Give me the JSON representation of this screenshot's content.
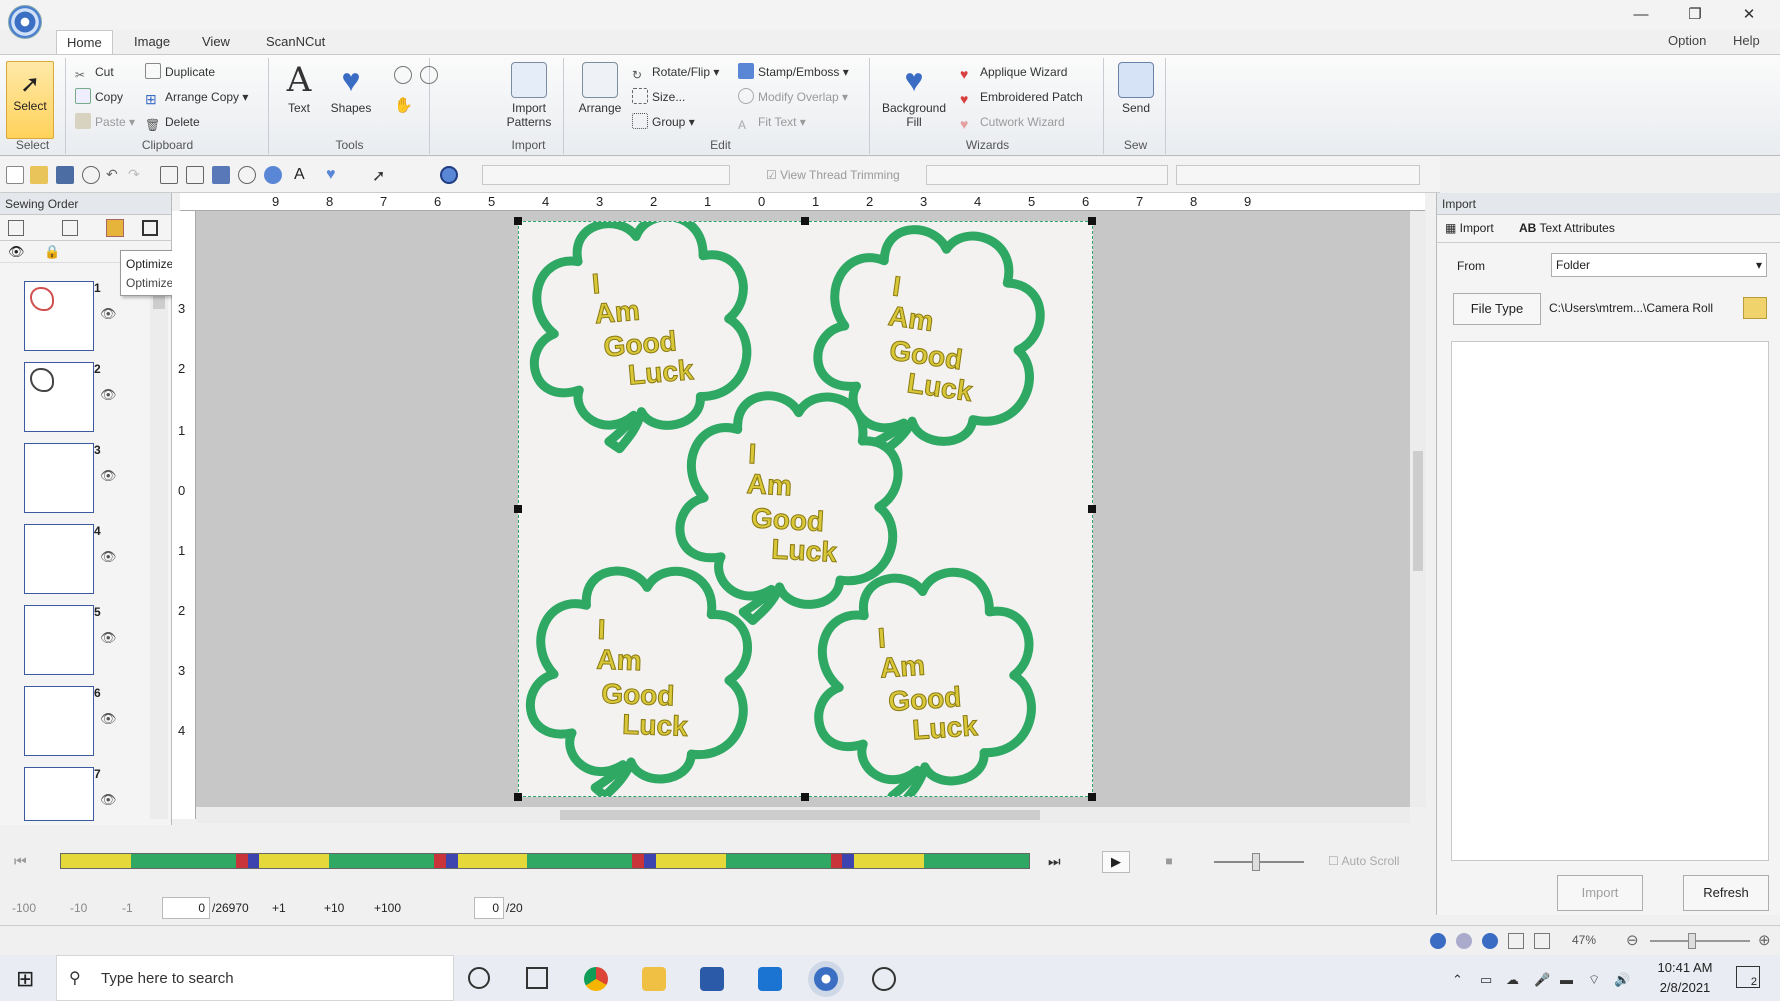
{
  "window": {
    "minimize": "—",
    "restore": "❐",
    "close": "✕"
  },
  "menu": {
    "tabs": [
      "Home",
      "Image",
      "View",
      "ScanNCut"
    ],
    "option": "Option",
    "help": "Help"
  },
  "ribbon": {
    "select": {
      "label": "Select",
      "group": "Select"
    },
    "clipboard": {
      "cut": "Cut",
      "copy": "Copy",
      "paste": "Paste",
      "duplicate": "Duplicate",
      "arrange_copy": "Arrange Copy",
      "delete": "Delete",
      "group": "Clipboard"
    },
    "tools": {
      "text": "Text",
      "shapes": "Shapes",
      "group": "Tools"
    },
    "import": {
      "label": "Import Patterns",
      "group": "Import"
    },
    "edit": {
      "arrange": "Arrange",
      "rotate_flip": "Rotate/Flip",
      "size": "Size...",
      "group_btn": "Group",
      "stamp": "Stamp/Emboss",
      "modify_overlap": "Modify Overlap",
      "fit_text": "Fit Text",
      "group": "Edit"
    },
    "wizards": {
      "background_fill": "Background Fill",
      "applique": "Applique Wizard",
      "embroidered_patch": "Embroidered Patch",
      "cutwork": "Cutwork Wizard",
      "group": "Wizards"
    },
    "sew": {
      "send": "Send",
      "group": "Sew"
    }
  },
  "toolbar2": {
    "view_thread_trimming": "View Thread Trimming"
  },
  "sewing_panel": {
    "title": "Sewing Order",
    "items": [
      "1",
      "2",
      "3",
      "4",
      "5",
      "6",
      "7"
    ],
    "tooltip_title": "Optimize Sewing Order",
    "tooltip_desc": "Optimizes the sewing order."
  },
  "rulers": {
    "top": [
      "9",
      "8",
      "7",
      "6",
      "5",
      "4",
      "3",
      "2",
      "1",
      "0",
      "1",
      "2",
      "3",
      "4",
      "5",
      "6",
      "7",
      "8",
      "9"
    ],
    "left": [
      "3",
      "2",
      "1",
      "0",
      "1",
      "2",
      "3",
      "4"
    ]
  },
  "design": {
    "text_line1": "I",
    "text_line2": "Am",
    "text_line3": "Good",
    "text_line4": "Luck",
    "outline_color": "#2fa864",
    "fill_color": "#f3f2f0",
    "text_color": "#d9c73a"
  },
  "playback": {
    "stitch_value": "0",
    "stitch_total": "/26970",
    "step_minus100": "-100",
    "step_minus10": "-10",
    "step_minus1": "-1",
    "step_plus1": "+1",
    "step_plus10": "+10",
    "step_plus100": "+100",
    "color_value": "0",
    "color_total": "/20",
    "auto_scroll": "Auto Scroll",
    "strip_colors": [
      "#e4d83a",
      "#2fa864",
      "#c8343a",
      "#3d44b0",
      "#e4d83a",
      "#2fa864"
    ]
  },
  "import_panel": {
    "title": "Import",
    "tab_import": "Import",
    "tab_text_attributes": "Text Attributes",
    "from_label": "From",
    "from_value": "Folder",
    "file_type_button": "File Type",
    "path": "C:\\Users\\mtrem...\\Camera Roll",
    "import_button": "Import",
    "refresh_button": "Refresh"
  },
  "status": {
    "zoom": "47%"
  },
  "taskbar": {
    "search_placeholder": "Type here to search",
    "time": "10:41 AM",
    "date": "2/8/2021",
    "notif_count": "2"
  }
}
